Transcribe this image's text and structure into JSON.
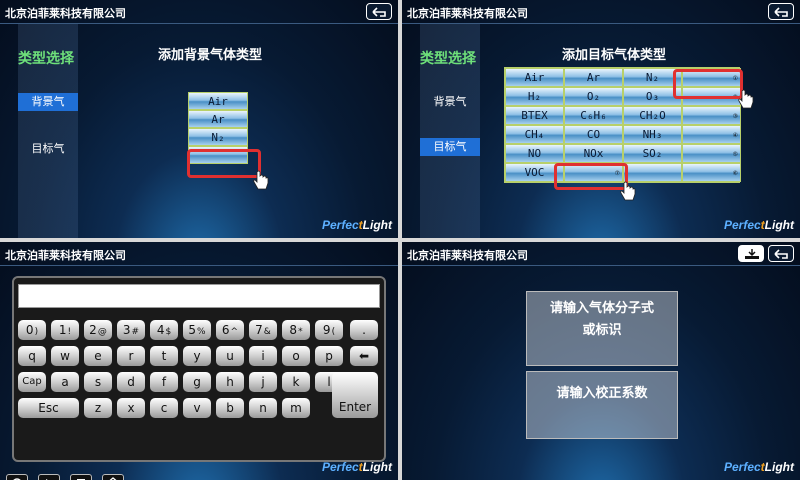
{
  "company": "北京泊菲莱科技有限公司",
  "logo": {
    "part1": "Perfec",
    "part2": "t",
    "part3": "Light"
  },
  "panel1": {
    "sidebar_title": "类型选择",
    "side_items": [
      "背景气",
      "目标气"
    ],
    "heading": "添加背景气体类型",
    "gases": [
      "Air",
      "Ar",
      "N₂"
    ]
  },
  "panel2": {
    "sidebar_title": "类型选择",
    "side_items": [
      "背景气",
      "目标气"
    ],
    "heading": "添加目标气体类型",
    "grid": [
      [
        "Air",
        "Ar",
        "N₂",
        ""
      ],
      [
        "H₂",
        "O₂",
        "O₃",
        ""
      ],
      [
        "BTEX",
        "C₆H₆",
        "CH₂O",
        ""
      ],
      [
        "CH₄",
        "CO",
        "NH₃",
        ""
      ],
      [
        "NO",
        "NOx",
        "SO₂",
        ""
      ],
      [
        "VOC",
        "",
        "",
        ""
      ]
    ],
    "indices": [
      "①",
      "②",
      "③",
      "④",
      "⑤",
      "⑥",
      "⑦"
    ]
  },
  "panel3": {
    "row1": [
      [
        "0",
        ")"
      ],
      [
        "1",
        "!"
      ],
      [
        "2",
        "@"
      ],
      [
        "3",
        "#"
      ],
      [
        "4",
        "$"
      ],
      [
        "5",
        "%"
      ],
      [
        "6",
        "^"
      ],
      [
        "7",
        "&"
      ],
      [
        "8",
        "*"
      ],
      [
        "9",
        "("
      ],
      [
        ".",
        ""
      ]
    ],
    "row2": [
      "q",
      "w",
      "e",
      "r",
      "t",
      "y",
      "u",
      "i",
      "o",
      "p"
    ],
    "row3": [
      "Cap",
      "a",
      "s",
      "d",
      "f",
      "g",
      "h",
      "j",
      "k",
      "l"
    ],
    "row4": [
      "Esc",
      "z",
      "x",
      "c",
      "v",
      "b",
      "n",
      "m"
    ],
    "enter": "Enter",
    "backspace": "⬅"
  },
  "panel4": {
    "formula_prompt_line1": "请输入气体分子式",
    "formula_prompt_line2": "或标识",
    "coef_prompt": "请输入校正系数"
  }
}
